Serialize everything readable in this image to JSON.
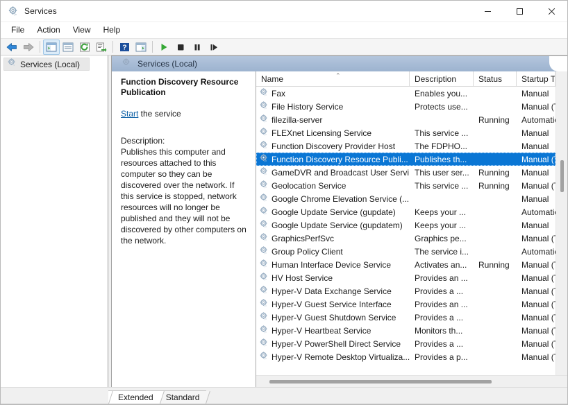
{
  "window": {
    "title": "Services",
    "icon": "services-gear-icon",
    "controls": {
      "minimize": "minimize-icon",
      "maximize": "maximize-icon",
      "close": "close-icon"
    }
  },
  "menubar": {
    "items": [
      {
        "label": "File"
      },
      {
        "label": "Action"
      },
      {
        "label": "View"
      },
      {
        "label": "Help"
      }
    ]
  },
  "toolbar": {
    "buttons": [
      {
        "name": "back-icon",
        "kind": "sep",
        "is_separator": false
      },
      {
        "name": "forward-icon"
      },
      {
        "name": "show-hide-tree-icon"
      },
      {
        "name": "properties-icon"
      },
      {
        "name": "refresh-icon"
      },
      {
        "name": "export-list-icon"
      },
      {
        "name": "help-icon"
      },
      {
        "name": "show-hide-action-pane-icon"
      },
      {
        "name": "start-service-icon"
      },
      {
        "name": "stop-service-icon"
      },
      {
        "name": "pause-service-icon"
      },
      {
        "name": "restart-service-icon"
      }
    ]
  },
  "tree": {
    "root_label": "Services (Local)"
  },
  "pane": {
    "header_label": "Services (Local)"
  },
  "detail": {
    "title": "Function Discovery Resource Publication",
    "action_link": "Start",
    "action_suffix": " the service",
    "description_label": "Description:",
    "description_body": "Publishes this computer and resources attached to this computer so they can be discovered over the network.  If this service is stopped, network resources will no longer be published and they will not be discovered by other computers on the network."
  },
  "list": {
    "columns": [
      {
        "key": "name",
        "label": "Name",
        "sorted": "asc",
        "sort_glyph": "⌃"
      },
      {
        "key": "desc",
        "label": "Description"
      },
      {
        "key": "status",
        "label": "Status"
      },
      {
        "key": "startup",
        "label": "Startup Typ"
      }
    ],
    "rows": [
      {
        "name": "Fax",
        "desc": "Enables you...",
        "status": "",
        "startup": "Manual",
        "selected": false
      },
      {
        "name": "File History Service",
        "desc": "Protects use...",
        "status": "",
        "startup": "Manual (Tr",
        "selected": false
      },
      {
        "name": "filezilla-server",
        "desc": "",
        "status": "Running",
        "startup": "Automatic",
        "selected": false
      },
      {
        "name": "FLEXnet Licensing Service",
        "desc": "This service ...",
        "status": "",
        "startup": "Manual",
        "selected": false
      },
      {
        "name": "Function Discovery Provider Host",
        "desc": "The FDPHO...",
        "status": "",
        "startup": "Manual",
        "selected": false
      },
      {
        "name": "Function Discovery Resource Publi...",
        "desc": "Publishes th...",
        "status": "",
        "startup": "Manual (Tr",
        "selected": true
      },
      {
        "name": "GameDVR and Broadcast User Servi...",
        "desc": "This user ser...",
        "status": "Running",
        "startup": "Manual",
        "selected": false
      },
      {
        "name": "Geolocation Service",
        "desc": "This service ...",
        "status": "Running",
        "startup": "Manual (Tr",
        "selected": false
      },
      {
        "name": "Google Chrome Elevation Service (...",
        "desc": "",
        "status": "",
        "startup": "Manual",
        "selected": false
      },
      {
        "name": "Google Update Service (gupdate)",
        "desc": "Keeps your ...",
        "status": "",
        "startup": "Automatic",
        "selected": false
      },
      {
        "name": "Google Update Service (gupdatem)",
        "desc": "Keeps your ...",
        "status": "",
        "startup": "Manual",
        "selected": false
      },
      {
        "name": "GraphicsPerfSvc",
        "desc": "Graphics pe...",
        "status": "",
        "startup": "Manual (Tr",
        "selected": false
      },
      {
        "name": "Group Policy Client",
        "desc": "The service i...",
        "status": "",
        "startup": "Automatic",
        "selected": false
      },
      {
        "name": "Human Interface Device Service",
        "desc": "Activates an...",
        "status": "Running",
        "startup": "Manual (Tr",
        "selected": false
      },
      {
        "name": "HV Host Service",
        "desc": "Provides an ...",
        "status": "",
        "startup": "Manual (Tr",
        "selected": false
      },
      {
        "name": "Hyper-V Data Exchange Service",
        "desc": "Provides a ...",
        "status": "",
        "startup": "Manual (Tr",
        "selected": false
      },
      {
        "name": "Hyper-V Guest Service Interface",
        "desc": "Provides an ...",
        "status": "",
        "startup": "Manual (Tr",
        "selected": false
      },
      {
        "name": "Hyper-V Guest Shutdown Service",
        "desc": "Provides a ...",
        "status": "",
        "startup": "Manual (Tr",
        "selected": false
      },
      {
        "name": "Hyper-V Heartbeat Service",
        "desc": "Monitors th...",
        "status": "",
        "startup": "Manual (Tr",
        "selected": false
      },
      {
        "name": "Hyper-V PowerShell Direct Service",
        "desc": "Provides a ...",
        "status": "",
        "startup": "Manual (Tr",
        "selected": false
      },
      {
        "name": "Hyper-V Remote Desktop Virtualiza...",
        "desc": "Provides a p...",
        "status": "",
        "startup": "Manual (Tr",
        "selected": false
      }
    ]
  },
  "tabs": [
    {
      "label": "Extended",
      "active": true
    },
    {
      "label": "Standard",
      "active": false
    }
  ],
  "colors": {
    "selection": "#0a76d4",
    "link": "#0b5fa5",
    "pane_header": "#a8bcd6",
    "toolbar_bg": "#f5f5f5"
  }
}
